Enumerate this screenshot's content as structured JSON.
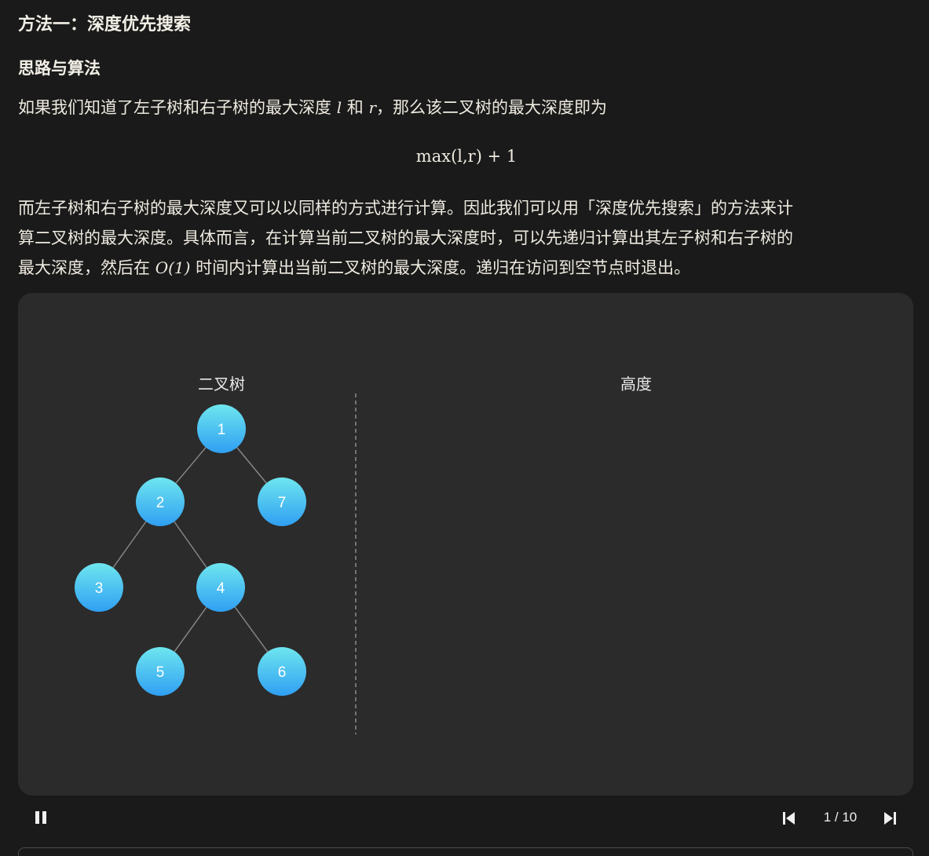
{
  "article": {
    "heading": "方法一：深度优先搜索",
    "subheading": "思路与算法",
    "para1": {
      "t1": "如果我们知道了左子树和右子树的最大深度 ",
      "v1": "l",
      "t2": " 和 ",
      "v2": "r",
      "t3": "，那么该二叉树的最大深度即为"
    },
    "formula": "max(l,r) + 1",
    "para2": {
      "line1": "而左子树和右子树的最大深度又可以以同样的方式进行计算。因此我们可以用「深度优先搜索」的方法来计",
      "line2": "算二叉树的最大深度。具体而言，在计算当前二叉树的最大深度时，可以先递归计算出其左子树和右子树的",
      "line3a": "最大深度，然后在 ",
      "line3math": "O(1)",
      "line3b": " 时间内计算出当前二叉树的最大深度。递归在访问到空节点时退出。"
    }
  },
  "animation": {
    "left_title": "二叉树",
    "right_title": "高度",
    "tree": {
      "nodes": [
        {
          "id": "1",
          "label": "1"
        },
        {
          "id": "2",
          "label": "2"
        },
        {
          "id": "7",
          "label": "7"
        },
        {
          "id": "3",
          "label": "3"
        },
        {
          "id": "4",
          "label": "4"
        },
        {
          "id": "5",
          "label": "5"
        },
        {
          "id": "6",
          "label": "6"
        }
      ],
      "edges": [
        [
          "1",
          "2"
        ],
        [
          "1",
          "7"
        ],
        [
          "2",
          "3"
        ],
        [
          "2",
          "4"
        ],
        [
          "4",
          "5"
        ],
        [
          "4",
          "6"
        ]
      ]
    },
    "colors": {
      "node_top": "#6fe6ef",
      "node_bottom": "#2f9ff2",
      "edge": "#8a8a8a",
      "divider": "#9a9a9a"
    }
  },
  "controls": {
    "pause_icon": "pause-icon",
    "prev_icon": "skip-previous-icon",
    "next_icon": "skip-next-icon",
    "progress": "1 / 10"
  }
}
